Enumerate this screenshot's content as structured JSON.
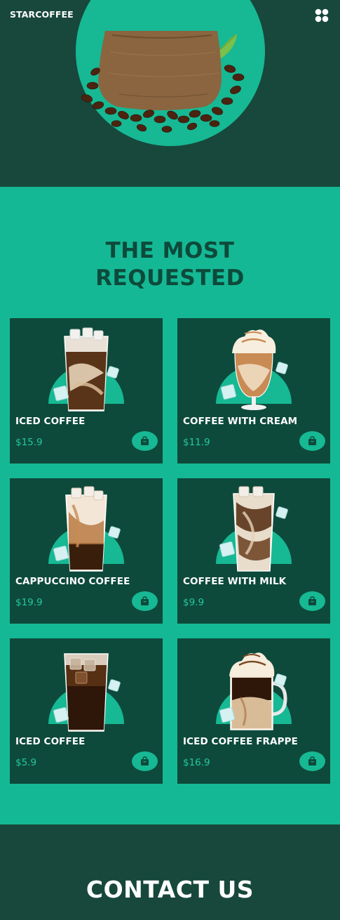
{
  "header": {
    "brand": "STARCOFFEE",
    "menu_icon": "grid-menu-icon"
  },
  "colors": {
    "dark_green": "#17483b",
    "card_green": "#0d4a3b",
    "accent": "#15b894",
    "price": "#25c8a0"
  },
  "hero": {
    "image": "coffee-bean-sack"
  },
  "requested": {
    "title_line1": "THE MOST",
    "title_line2": "REQUESTED",
    "cart_icon": "shopping-bag-icon",
    "products": [
      {
        "name": "ICED COFFEE",
        "price": "$15.9",
        "image": "iced-coffee-glass"
      },
      {
        "name": "COFFEE WITH CREAM",
        "price": "$11.9",
        "image": "cream-coffee-goblet"
      },
      {
        "name": "CAPPUCCINO COFFEE",
        "price": "$19.9",
        "image": "cappuccino-glass"
      },
      {
        "name": "COFFEE WITH MILK",
        "price": "$9.9",
        "image": "milk-coffee-glass"
      },
      {
        "name": "ICED COFFEE",
        "price": "$5.9",
        "image": "iced-black-coffee-glass"
      },
      {
        "name": "ICED COFFEE FRAPPE",
        "price": "$16.9",
        "image": "frappe-mug"
      }
    ]
  },
  "contact": {
    "title": "CONTACT US"
  }
}
